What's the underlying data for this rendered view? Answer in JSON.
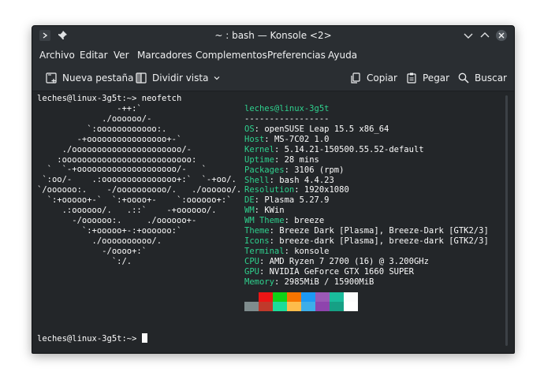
{
  "window": {
    "title": "~ : bash — Konsole <2>"
  },
  "menu": [
    "Archivo",
    "Editar",
    "Ver",
    "Marcadores",
    "Complementos",
    "Preferencias",
    "Ayuda"
  ],
  "toolbar": {
    "new_tab": "Nueva pestaña",
    "split_view": "Dividir vista",
    "copy": "Copiar",
    "paste": "Pegar",
    "find": "Buscar"
  },
  "terminal": {
    "command_line": "leches@linux-3g5t:~> neofetch",
    "final_prompt": "leches@linux-3g5t:~> ",
    "logo": [
      "                -++:`",
      "             ./oooooo/-",
      "          `:oooooooooooo:.",
      "        -+oooooooooooooooo+-`",
      "     ./oooooooooooooooooooooo/-",
      "    :oooooooooooooooooooooooooo:",
      "  `  `-+oooooooooooooooooooo/-   `",
      " `:oo/-    .:ooooooooooooooo+:`  `-+oo/.",
      "`/oooooo:.    -/oooooooooo/.   ./oooooo/.",
      "  `:+ooooo+-`  `:+oooo+-    `:oooooo+:`",
      "     .:oooooo/.   .::`    -+oooooo/.",
      "       -/oooooo:.     ./oooooo+-",
      "         `:+ooooo+-:+oooooo:`",
      "           ./oooooooooo/.",
      "             -/oooo+:`",
      "               `:/."
    ],
    "info": {
      "user_host": "leches@linux-3g5t",
      "separator": "-----------------",
      "rows": [
        {
          "key": "OS",
          "value": "openSUSE Leap 15.5 x86_64"
        },
        {
          "key": "Host",
          "value": "MS-7C02 1.0"
        },
        {
          "key": "Kernel",
          "value": "5.14.21-150500.55.52-default"
        },
        {
          "key": "Uptime",
          "value": "28 mins"
        },
        {
          "key": "Packages",
          "value": "3106 (rpm)"
        },
        {
          "key": "Shell",
          "value": "bash 4.4.23"
        },
        {
          "key": "Resolution",
          "value": "1920x1080"
        },
        {
          "key": "DE",
          "value": "Plasma 5.27.9"
        },
        {
          "key": "WM",
          "value": "KWin"
        },
        {
          "key": "WM Theme",
          "value": "breeze"
        },
        {
          "key": "Theme",
          "value": "Breeze Dark [Plasma], Breeze-Dark [GTK2/3]"
        },
        {
          "key": "Icons",
          "value": "breeze-dark [Plasma], breeze-dark [GTK2/3]"
        },
        {
          "key": "Terminal",
          "value": "konsole"
        },
        {
          "key": "CPU",
          "value": "AMD Ryzen 7 2700 (16) @ 3.200GHz"
        },
        {
          "key": "GPU",
          "value": "NVIDIA GeForce GTX 1660 SUPER"
        },
        {
          "key": "Memory",
          "value": "2985MiB / 15900MiB"
        }
      ]
    },
    "palette_top": [
      "#232629",
      "#ed1515",
      "#11d116",
      "#f67400",
      "#1d99f3",
      "#9b59b6",
      "#1abc9c",
      "#fcfcfc"
    ],
    "palette_bottom": [
      "#7f8c8d",
      "#c0392b",
      "#1cdc9a",
      "#fdbc4b",
      "#3daee9",
      "#8e44ad",
      "#16a085",
      "#ffffff"
    ]
  }
}
